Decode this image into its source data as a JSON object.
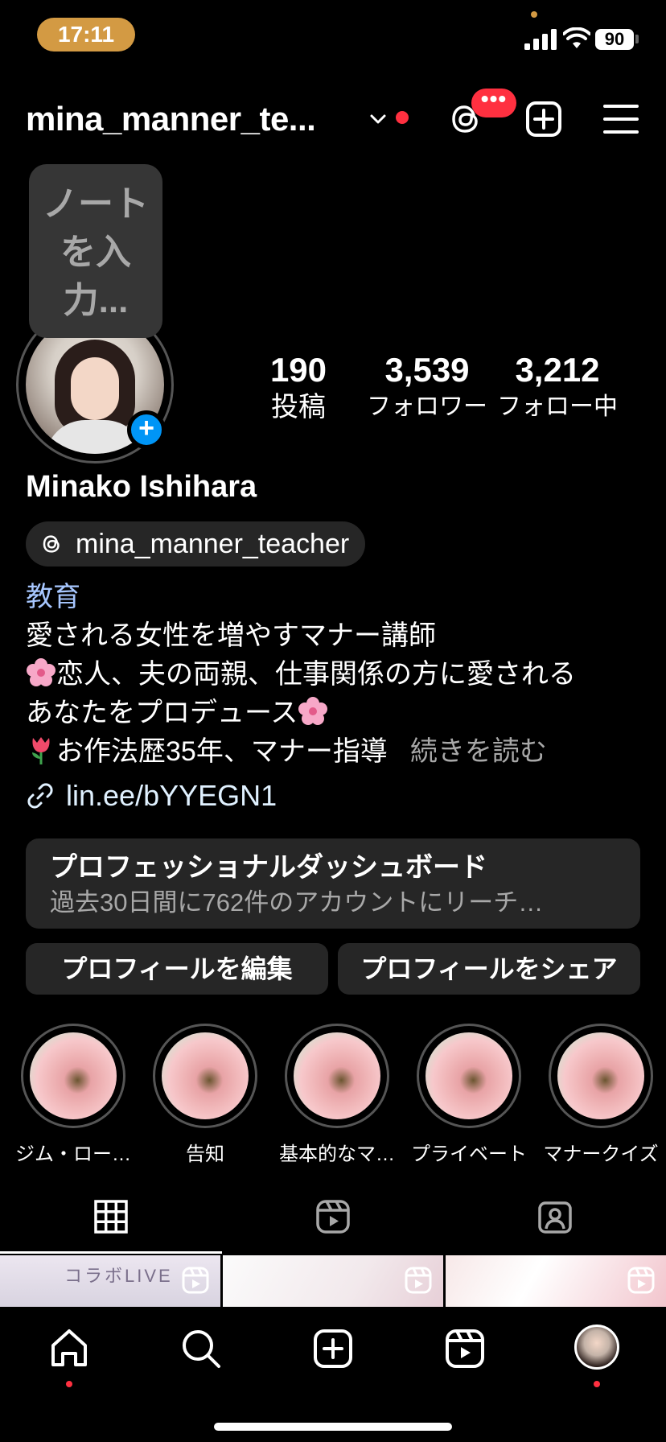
{
  "status_bar": {
    "time": "17:11",
    "battery": "90"
  },
  "header": {
    "username": "mina_manner_te...",
    "threads_badge": "•••"
  },
  "note": {
    "text": "ノートを入力..."
  },
  "stats": {
    "posts": {
      "value": "190",
      "label": "投稿"
    },
    "followers": {
      "value": "3,539",
      "label": "フォロワー"
    },
    "following": {
      "value": "3,212",
      "label": "フォロー中"
    }
  },
  "profile": {
    "display_name": "Minako Ishihara",
    "threads_handle": "mina_manner_teacher",
    "category": "教育",
    "bio_lines": [
      "愛される女性を増やすマナー講師",
      "恋人、夫の両親、仕事関係の方に愛される",
      "あなたをプロデュース",
      "お作法歴35年、マナー指導"
    ],
    "more": "続きを読む",
    "link": "lin.ee/bYYEGN1"
  },
  "dashboard": {
    "title": "プロフェッショナルダッシュボード",
    "subtitle": "過去30日間に762件のアカウントにリーチ…"
  },
  "buttons": {
    "edit": "プロフィールを編集",
    "share": "プロフィールをシェア"
  },
  "highlights": [
    {
      "label": "ジム・ロー…"
    },
    {
      "label": "告知"
    },
    {
      "label": "基本的なマ…"
    },
    {
      "label": "プライベート"
    },
    {
      "label": "マナークイズ"
    }
  ],
  "tabs": [
    "grid-icon",
    "reels-icon",
    "tagged-icon"
  ],
  "grid": {
    "cell1_text": "コラボLIVE"
  },
  "colors": {
    "accent_blue": "#0095f6",
    "notify_red": "#ff3040",
    "time_pill": "#d39a43",
    "surface": "#262626"
  }
}
